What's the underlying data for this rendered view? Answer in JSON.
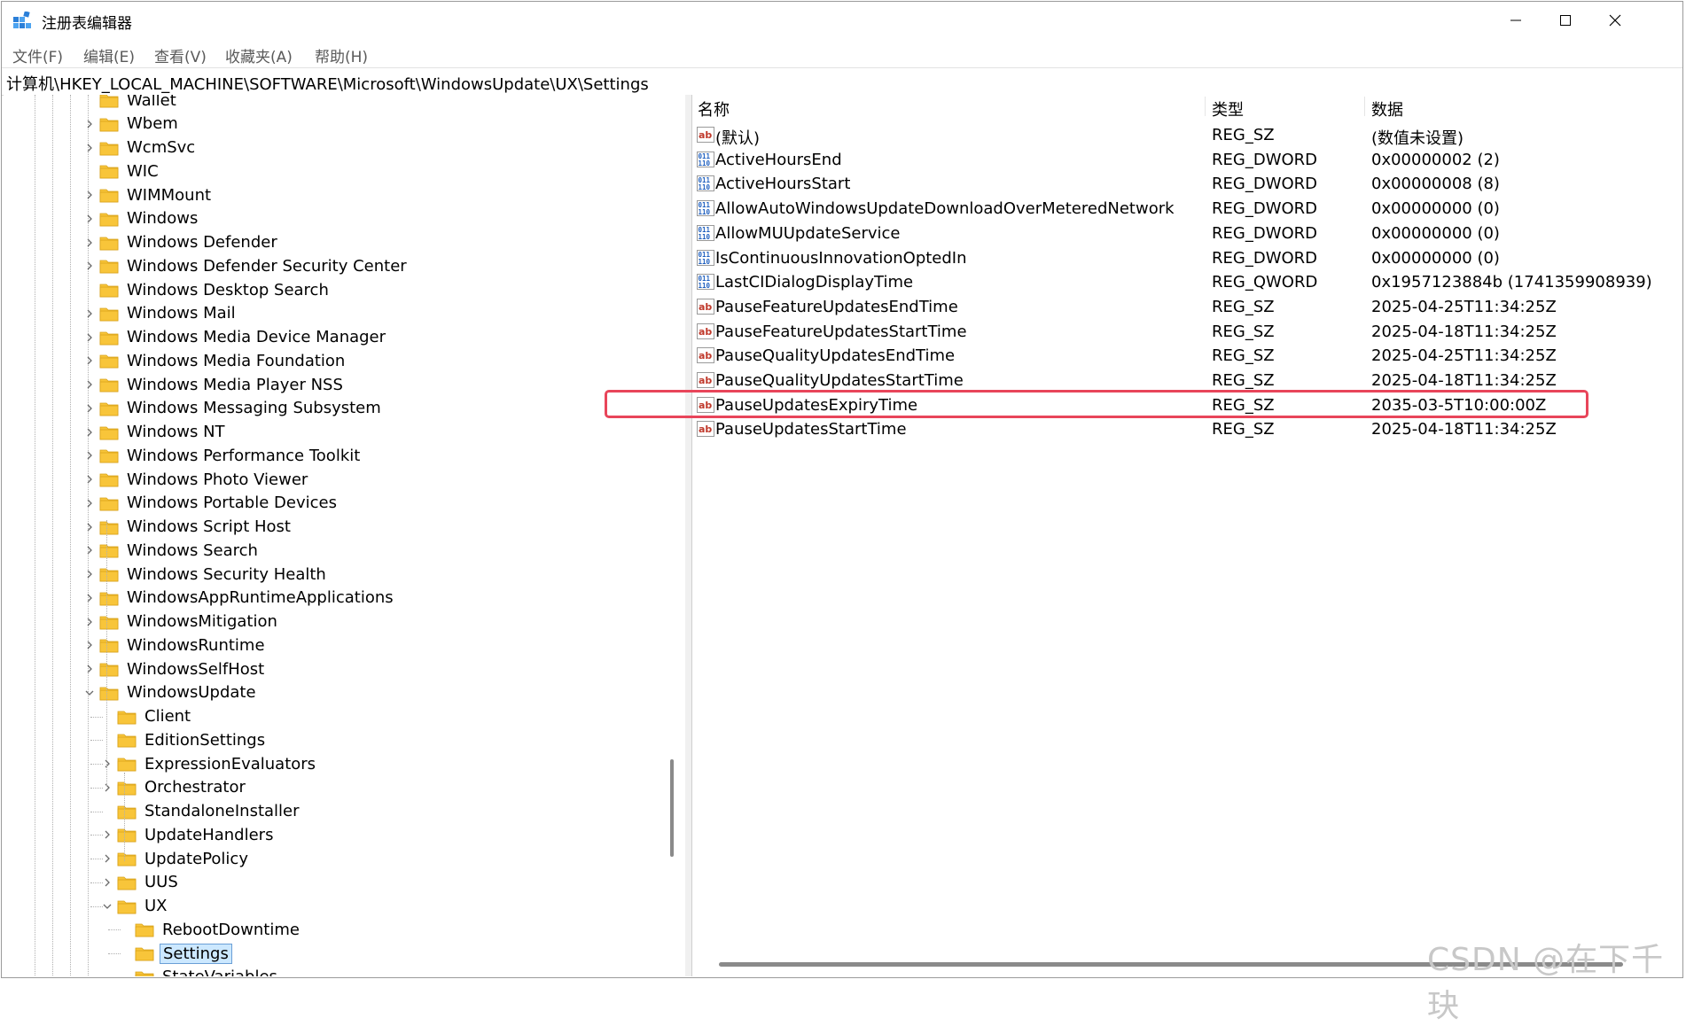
{
  "window": {
    "title": "注册表编辑器",
    "controls": {
      "minimize": "minimize-icon",
      "maximize": "maximize-icon",
      "close": "close-icon"
    }
  },
  "menu": [
    "文件(F)",
    "编辑(E)",
    "查看(V)",
    "收藏夹(A)",
    "帮助(H)"
  ],
  "address": "计算机\\HKEY_LOCAL_MACHINE\\SOFTWARE\\Microsoft\\WindowsUpdate\\UX\\Settings",
  "tree": [
    {
      "label": "Wallet",
      "level": 0,
      "expander": "none"
    },
    {
      "label": "Wbem",
      "level": 0,
      "expander": "collapsed"
    },
    {
      "label": "WcmSvc",
      "level": 0,
      "expander": "collapsed"
    },
    {
      "label": "WIC",
      "level": 0,
      "expander": "none"
    },
    {
      "label": "WIMMount",
      "level": 0,
      "expander": "collapsed"
    },
    {
      "label": "Windows",
      "level": 0,
      "expander": "collapsed"
    },
    {
      "label": "Windows Defender",
      "level": 0,
      "expander": "collapsed"
    },
    {
      "label": "Windows Defender Security Center",
      "level": 0,
      "expander": "collapsed"
    },
    {
      "label": "Windows Desktop Search",
      "level": 0,
      "expander": "none"
    },
    {
      "label": "Windows Mail",
      "level": 0,
      "expander": "collapsed"
    },
    {
      "label": "Windows Media Device Manager",
      "level": 0,
      "expander": "collapsed"
    },
    {
      "label": "Windows Media Foundation",
      "level": 0,
      "expander": "collapsed"
    },
    {
      "label": "Windows Media Player NSS",
      "level": 0,
      "expander": "collapsed"
    },
    {
      "label": "Windows Messaging Subsystem",
      "level": 0,
      "expander": "collapsed"
    },
    {
      "label": "Windows NT",
      "level": 0,
      "expander": "collapsed"
    },
    {
      "label": "Windows Performance Toolkit",
      "level": 0,
      "expander": "collapsed"
    },
    {
      "label": "Windows Photo Viewer",
      "level": 0,
      "expander": "collapsed"
    },
    {
      "label": "Windows Portable Devices",
      "level": 0,
      "expander": "collapsed"
    },
    {
      "label": "Windows Script Host",
      "level": 0,
      "expander": "collapsed"
    },
    {
      "label": "Windows Search",
      "level": 0,
      "expander": "collapsed"
    },
    {
      "label": "Windows Security Health",
      "level": 0,
      "expander": "collapsed"
    },
    {
      "label": "WindowsAppRuntimeApplications",
      "level": 0,
      "expander": "collapsed"
    },
    {
      "label": "WindowsMitigation",
      "level": 0,
      "expander": "collapsed"
    },
    {
      "label": "WindowsRuntime",
      "level": 0,
      "expander": "collapsed"
    },
    {
      "label": "WindowsSelfHost",
      "level": 0,
      "expander": "collapsed"
    },
    {
      "label": "WindowsUpdate",
      "level": 0,
      "expander": "expanded"
    },
    {
      "label": "Client",
      "level": 1,
      "expander": "none"
    },
    {
      "label": "EditionSettings",
      "level": 1,
      "expander": "none"
    },
    {
      "label": "ExpressionEvaluators",
      "level": 1,
      "expander": "collapsed"
    },
    {
      "label": "Orchestrator",
      "level": 1,
      "expander": "collapsed"
    },
    {
      "label": "StandaloneInstaller",
      "level": 1,
      "expander": "none"
    },
    {
      "label": "UpdateHandlers",
      "level": 1,
      "expander": "collapsed"
    },
    {
      "label": "UpdatePolicy",
      "level": 1,
      "expander": "collapsed"
    },
    {
      "label": "UUS",
      "level": 1,
      "expander": "collapsed"
    },
    {
      "label": "UX",
      "level": 1,
      "expander": "expanded"
    },
    {
      "label": "RebootDowntime",
      "level": 2,
      "expander": "none"
    },
    {
      "label": "Settings",
      "level": 2,
      "expander": "none",
      "selected": true
    },
    {
      "label": "StateVariables",
      "level": 2,
      "expander": "none"
    }
  ],
  "list": {
    "headers": {
      "name": "名称",
      "type": "类型",
      "data": "数据"
    },
    "rows": [
      {
        "icon": "string-value-icon",
        "name": "(默认)",
        "type": "REG_SZ",
        "data": "(数值未设置)"
      },
      {
        "icon": "binary-value-icon",
        "name": "ActiveHoursEnd",
        "type": "REG_DWORD",
        "data": "0x00000002 (2)"
      },
      {
        "icon": "binary-value-icon",
        "name": "ActiveHoursStart",
        "type": "REG_DWORD",
        "data": "0x00000008 (8)"
      },
      {
        "icon": "binary-value-icon",
        "name": "AllowAutoWindowsUpdateDownloadOverMeteredNetwork",
        "type": "REG_DWORD",
        "data": "0x00000000 (0)"
      },
      {
        "icon": "binary-value-icon",
        "name": "AllowMUUpdateService",
        "type": "REG_DWORD",
        "data": "0x00000000 (0)"
      },
      {
        "icon": "binary-value-icon",
        "name": "IsContinuousInnovationOptedIn",
        "type": "REG_DWORD",
        "data": "0x00000000 (0)"
      },
      {
        "icon": "binary-value-icon",
        "name": "LastCIDialogDisplayTime",
        "type": "REG_QWORD",
        "data": "0x1957123884b (1741359908939)"
      },
      {
        "icon": "string-value-icon",
        "name": "PauseFeatureUpdatesEndTime",
        "type": "REG_SZ",
        "data": "2025-04-25T11:34:25Z"
      },
      {
        "icon": "string-value-icon",
        "name": "PauseFeatureUpdatesStartTime",
        "type": "REG_SZ",
        "data": "2025-04-18T11:34:25Z"
      },
      {
        "icon": "string-value-icon",
        "name": "PauseQualityUpdatesEndTime",
        "type": "REG_SZ",
        "data": "2025-04-25T11:34:25Z"
      },
      {
        "icon": "string-value-icon",
        "name": "PauseQualityUpdatesStartTime",
        "type": "REG_SZ",
        "data": "2025-04-18T11:34:25Z"
      },
      {
        "icon": "string-value-icon",
        "name": "PauseUpdatesExpiryTime",
        "type": "REG_SZ",
        "data": "2035-03-5T10:00:00Z",
        "highlighted": true
      },
      {
        "icon": "string-value-icon",
        "name": "PauseUpdatesStartTime",
        "type": "REG_SZ",
        "data": "2025-04-18T11:34:25Z"
      }
    ]
  },
  "highlight_color": "#e8455a",
  "selection_color": "#cce8ff",
  "folder_color": "#f8c53a",
  "watermark": "CSDN @在下千玦"
}
